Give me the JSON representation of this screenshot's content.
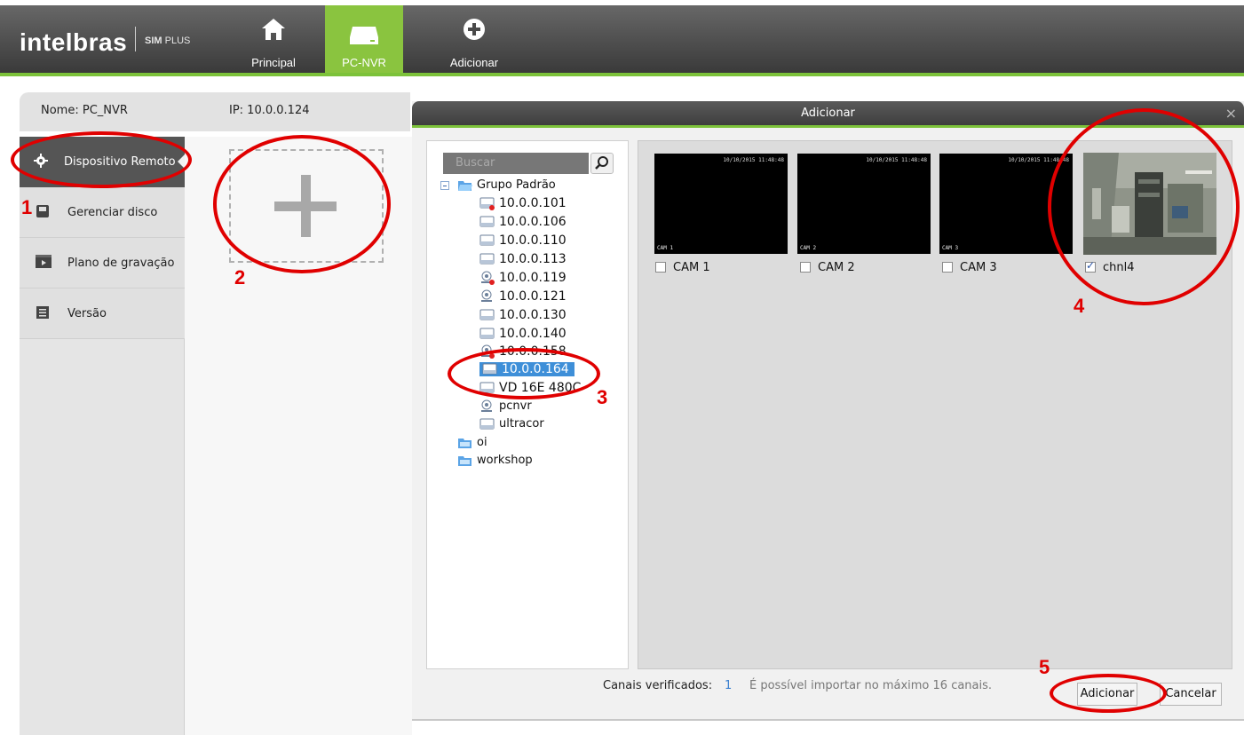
{
  "app": {
    "brand": "intelbras",
    "brand_sub_bold": "SIM",
    "brand_sub": " PLUS"
  },
  "nav": [
    {
      "label": "Principal",
      "icon": "home-icon"
    },
    {
      "label": "PC-NVR",
      "icon": "nvr-icon",
      "active": true
    },
    {
      "label": "Adicionar",
      "icon": "add-circle-icon"
    }
  ],
  "info": {
    "name_label": "Nome: PC_NVR",
    "ip_label": "IP: 10.0.0.124"
  },
  "sidebar": {
    "items": [
      {
        "label": "Dispositivo Remoto",
        "icon": "gear-icon",
        "active": true
      },
      {
        "label": "Gerenciar  disco",
        "icon": "disk-icon"
      },
      {
        "label": "Plano de gravação",
        "icon": "film-icon"
      },
      {
        "label": "Versão",
        "icon": "list-icon"
      }
    ]
  },
  "dialog": {
    "title": "Adicionar",
    "close": "×",
    "search_placeholder": "Buscar",
    "tree": {
      "group": "Grupo Padrão",
      "devices": [
        "10.0.0.101",
        "10.0.0.106",
        "10.0.0.110",
        "10.0.0.113",
        "10.0.0.119",
        "10.0.0.121",
        "10.0.0.130",
        "10.0.0.140",
        "10.0.0.158",
        "10.0.0.164",
        "VD 16E 480C",
        "pcnvr",
        "ultracor"
      ],
      "selected": "10.0.0.164",
      "other_groups": [
        "oi",
        "workshop"
      ]
    },
    "cameras": [
      {
        "label": "CAM 1",
        "overlay": "CAM 1",
        "timestamp": "10/10/2015 11:48:48",
        "checked": false
      },
      {
        "label": "CAM 2",
        "overlay": "CAM 2",
        "timestamp": "10/10/2015 11:48:48",
        "checked": false
      },
      {
        "label": "CAM 3",
        "overlay": "CAM 3",
        "timestamp": "10/10/2015 11:48:48",
        "checked": false
      },
      {
        "label": "chnl4",
        "checked": true
      }
    ],
    "footer": {
      "verified_label": "Canais verificados:",
      "verified_count": "1",
      "note": "É possível importar no máximo 16 canais.",
      "add_button": "Adicionar",
      "cancel_button": "Cancelar"
    }
  },
  "annotations": [
    "1",
    "2",
    "3",
    "4",
    "5"
  ],
  "colors": {
    "accent_green": "#8ac43f",
    "annotation_red": "#e00000",
    "selection_blue": "#3e8fd8"
  }
}
